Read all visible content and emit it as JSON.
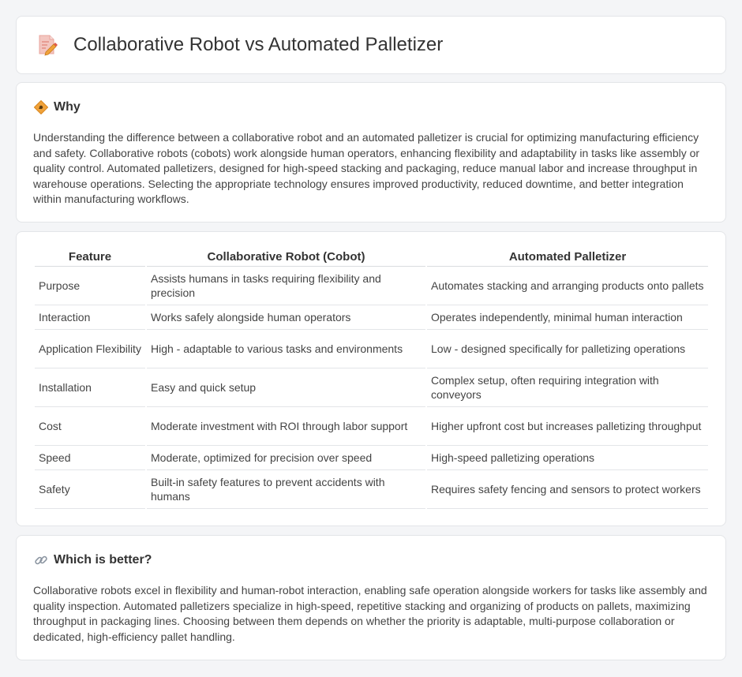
{
  "page": {
    "title": "Collaborative Robot vs Automated Palletizer"
  },
  "why": {
    "heading": "Why",
    "text": "Understanding the difference between a collaborative robot and an automated palletizer is crucial for optimizing manufacturing efficiency and safety. Collaborative robots (cobots) work alongside human operators, enhancing flexibility and adaptability in tasks like assembly or quality control. Automated palletizers, designed for high-speed stacking and packaging, reduce manual labor and increase throughput in warehouse operations. Selecting the appropriate technology ensures improved productivity, reduced downtime, and better integration within manufacturing workflows."
  },
  "table": {
    "headers": [
      "Feature",
      "Collaborative Robot (Cobot)",
      "Automated Palletizer"
    ],
    "rows": [
      [
        "Purpose",
        "Assists humans in tasks requiring flexibility and precision",
        "Automates stacking and arranging products onto pallets"
      ],
      [
        "Interaction",
        "Works safely alongside human operators",
        "Operates independently, minimal human interaction"
      ],
      [
        "Application Flexibility",
        "High - adaptable to various tasks and environments",
        "Low - designed specifically for palletizing operations"
      ],
      [
        "Installation",
        "Easy and quick setup",
        "Complex setup, often requiring integration with conveyors"
      ],
      [
        "Cost",
        "Moderate investment with ROI through labor support",
        "Higher upfront cost but increases palletizing throughput"
      ],
      [
        "Speed",
        "Moderate, optimized for precision over speed",
        "High-speed palletizing operations"
      ],
      [
        "Safety",
        "Built-in safety features to prevent accidents with humans",
        "Requires safety fencing and sensors to protect workers"
      ]
    ]
  },
  "better": {
    "heading": "Which is better?",
    "text": "Collaborative robots excel in flexibility and human-robot interaction, enabling safe operation alongside workers for tasks like assembly and quality inspection. Automated palletizers specialize in high-speed, repetitive stacking and organizing of products on pallets, maximizing throughput in packaging lines. Choosing between them depends on whether the priority is adaptable, multi-purpose collaboration or dedicated, high-efficiency pallet handling."
  },
  "icons": {
    "title": "document-pencil-icon",
    "why": "diamond-sign-icon",
    "better": "link-icon"
  },
  "colors": {
    "accent": "#f0a23a",
    "background": "#f4f5f7",
    "card": "#ffffff"
  }
}
